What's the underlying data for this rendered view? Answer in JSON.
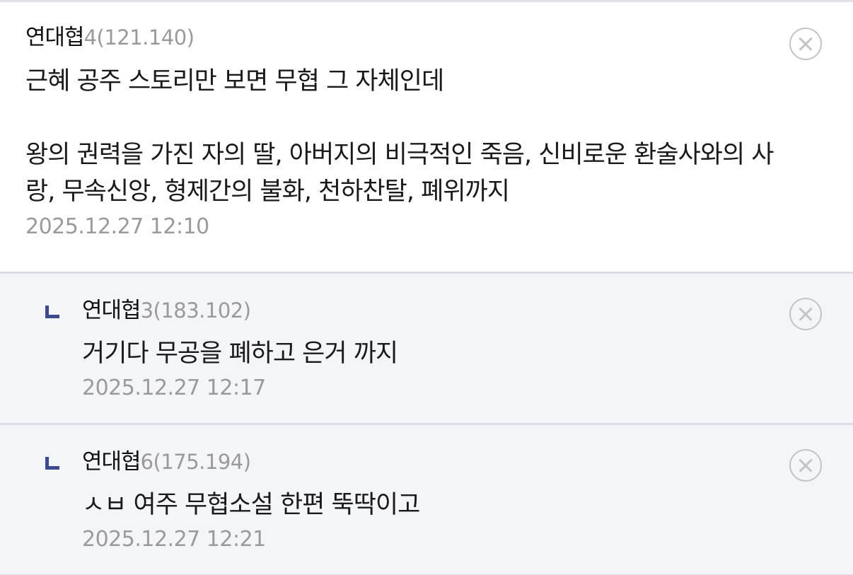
{
  "comments": [
    {
      "author": "연대협",
      "ip": "4(121.140)",
      "body": "근혜 공주 스토리만 보면 무협 그 자체인데\n\n왕의 권력을 가진 자의 딸, 아버지의 비극적인 죽음, 신비로운 환술사와의 사\n랑, 무속신앙, 형제간의 불화, 천하찬탈, 폐위까지",
      "time": "2025.12.27 12:10",
      "is_reply": false
    },
    {
      "author": "연대협",
      "ip": "3(183.102)",
      "body": "거기다 무공을 폐하고 은거 까지",
      "time": "2025.12.27 12:17",
      "is_reply": true
    },
    {
      "author": "연대협",
      "ip": "6(175.194)",
      "body": "ㅅㅂ 여주 무협소설 한편 뚝딱이고",
      "time": "2025.12.27 12:21",
      "is_reply": true
    }
  ],
  "icons": {
    "delete": "close-circle-icon",
    "reply": "reply-arrow-icon"
  },
  "colors": {
    "reply_background": "#f4f5f8",
    "reply_icon": "#3b4a8c",
    "meta_gray": "#9a9a9a"
  }
}
